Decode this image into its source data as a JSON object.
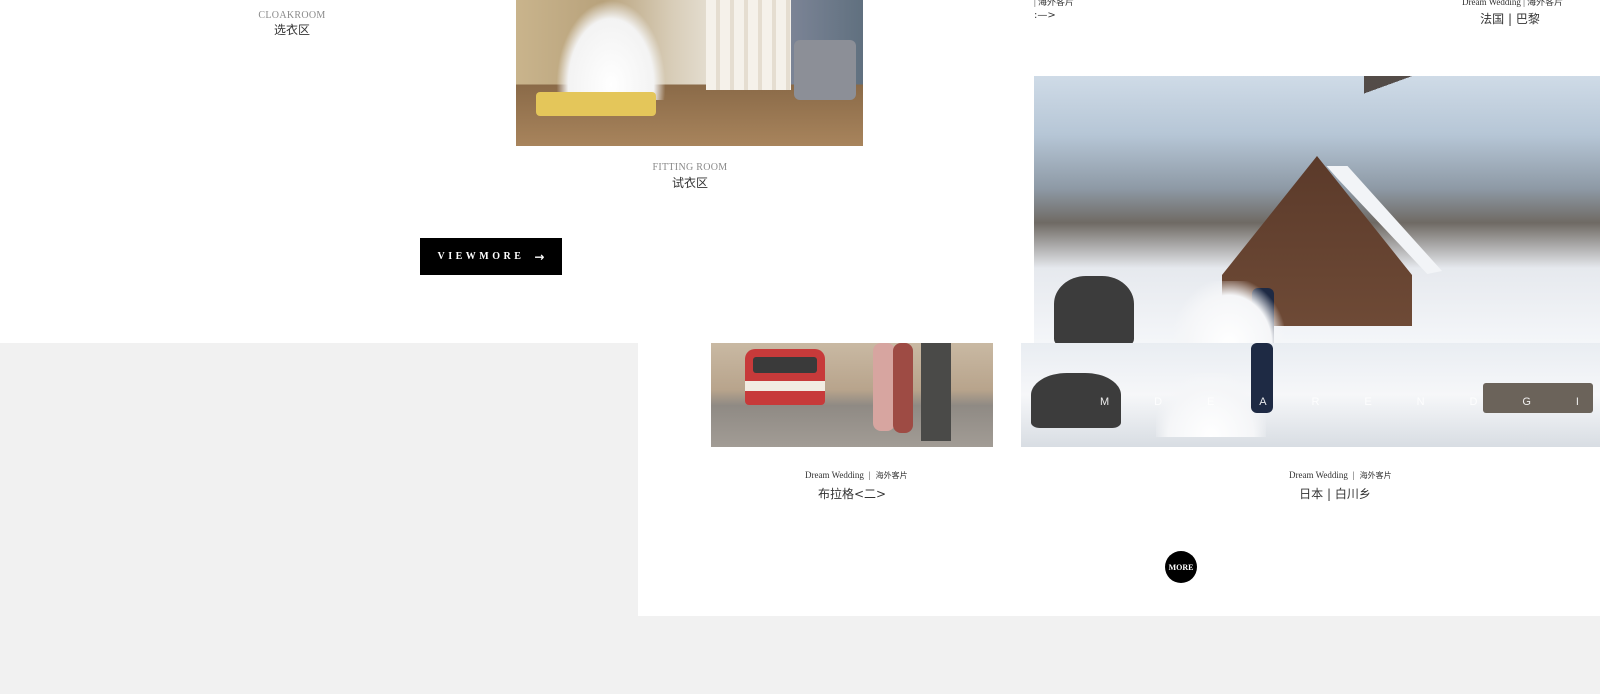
{
  "gallery": {
    "cloakroom": {
      "en": "CLOAKROOM",
      "zh": "选衣区"
    },
    "fitting_room": {
      "en": "FITTING ROOM",
      "zh": "试衣区"
    },
    "view_more_label": "VIEWMORE",
    "arrow_glyph": "→"
  },
  "albums": {
    "top_left_fragment": {
      "meta": "|  海外客片",
      "title": ":—>"
    },
    "top_right_fragment": {
      "meta": "Dream Wedding  |  海外客片",
      "title": "法国 | 巴黎"
    },
    "prague": {
      "brand": "Dream Wedding",
      "sep": "|",
      "category": "海外客片",
      "title": "布拉格<二>"
    },
    "shirakawa": {
      "brand": "Dream Wedding",
      "sep": "|",
      "category": "海外客片",
      "title": "日本 | 白川乡",
      "overlay_letters": [
        "M",
        "D",
        "E",
        "A",
        "R",
        "E",
        "N",
        "D",
        "G",
        "I"
      ]
    },
    "more_label": "MORE"
  }
}
